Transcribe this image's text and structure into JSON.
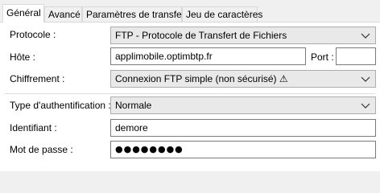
{
  "tabs": [
    {
      "label": "Général",
      "active": true
    },
    {
      "label": "Avancé",
      "active": false
    },
    {
      "label": "Paramètres de transfert",
      "active": false
    },
    {
      "label": "Jeu de caractères",
      "active": false
    }
  ],
  "form": {
    "protocol_label": "Protocole :",
    "protocol_value": "FTP - Protocole de Transfert de Fichiers",
    "host_label": "Hôte :",
    "host_value": "applimobile.optimbtp.fr",
    "port_label": "Port :",
    "port_value": "",
    "encryption_label": "Chiffrement :",
    "encryption_value": "Connexion FTP simple (non sécurisé) ⚠",
    "auth_label": "Type d'authentification :",
    "auth_value": "Normale",
    "user_label": "Identifiant :",
    "user_value": "demore",
    "password_label": "Mot de passe :",
    "password_value": "●●●●●●●●"
  },
  "icons": {
    "dropdown": "chevron-down-icon",
    "warning": "warning-icon"
  },
  "colors": {
    "panel_bg": "#ffffff",
    "window_bg": "#f0f0f0",
    "select_bg": "#e9e9e9",
    "border": "#7a7a7a"
  }
}
